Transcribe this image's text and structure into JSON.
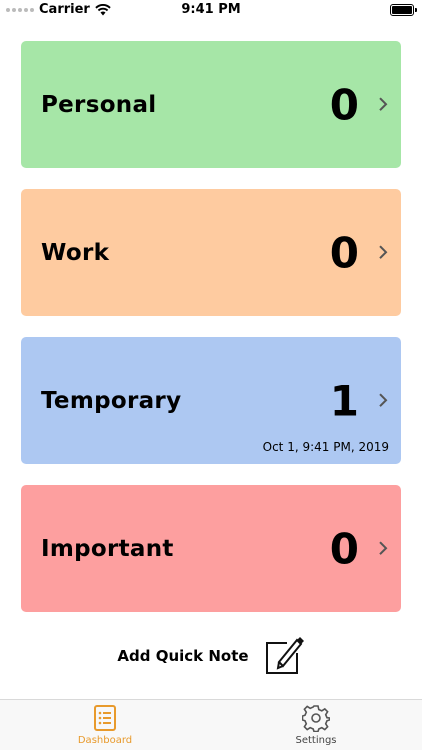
{
  "status_bar": {
    "carrier": "Carrier",
    "time": "9:41 PM"
  },
  "cards": [
    {
      "name": "Personal",
      "count": "0",
      "color": "#a6e6a7"
    },
    {
      "name": "Work",
      "count": "0",
      "color": "#fecba0"
    },
    {
      "name": "Temporary",
      "count": "1",
      "timestamp": "Oct 1, 9:41 PM, 2019",
      "color": "#adc8f2"
    },
    {
      "name": "Important",
      "count": "0",
      "color": "#fd9f9f"
    }
  ],
  "quick_note": {
    "label": "Add Quick Note",
    "icon": "compose-icon"
  },
  "tab_bar": {
    "tabs": [
      {
        "label": "Dashboard",
        "icon": "list-icon",
        "active": true,
        "color": "#e89a2c"
      },
      {
        "label": "Settings",
        "icon": "gear-icon",
        "active": false
      }
    ]
  }
}
